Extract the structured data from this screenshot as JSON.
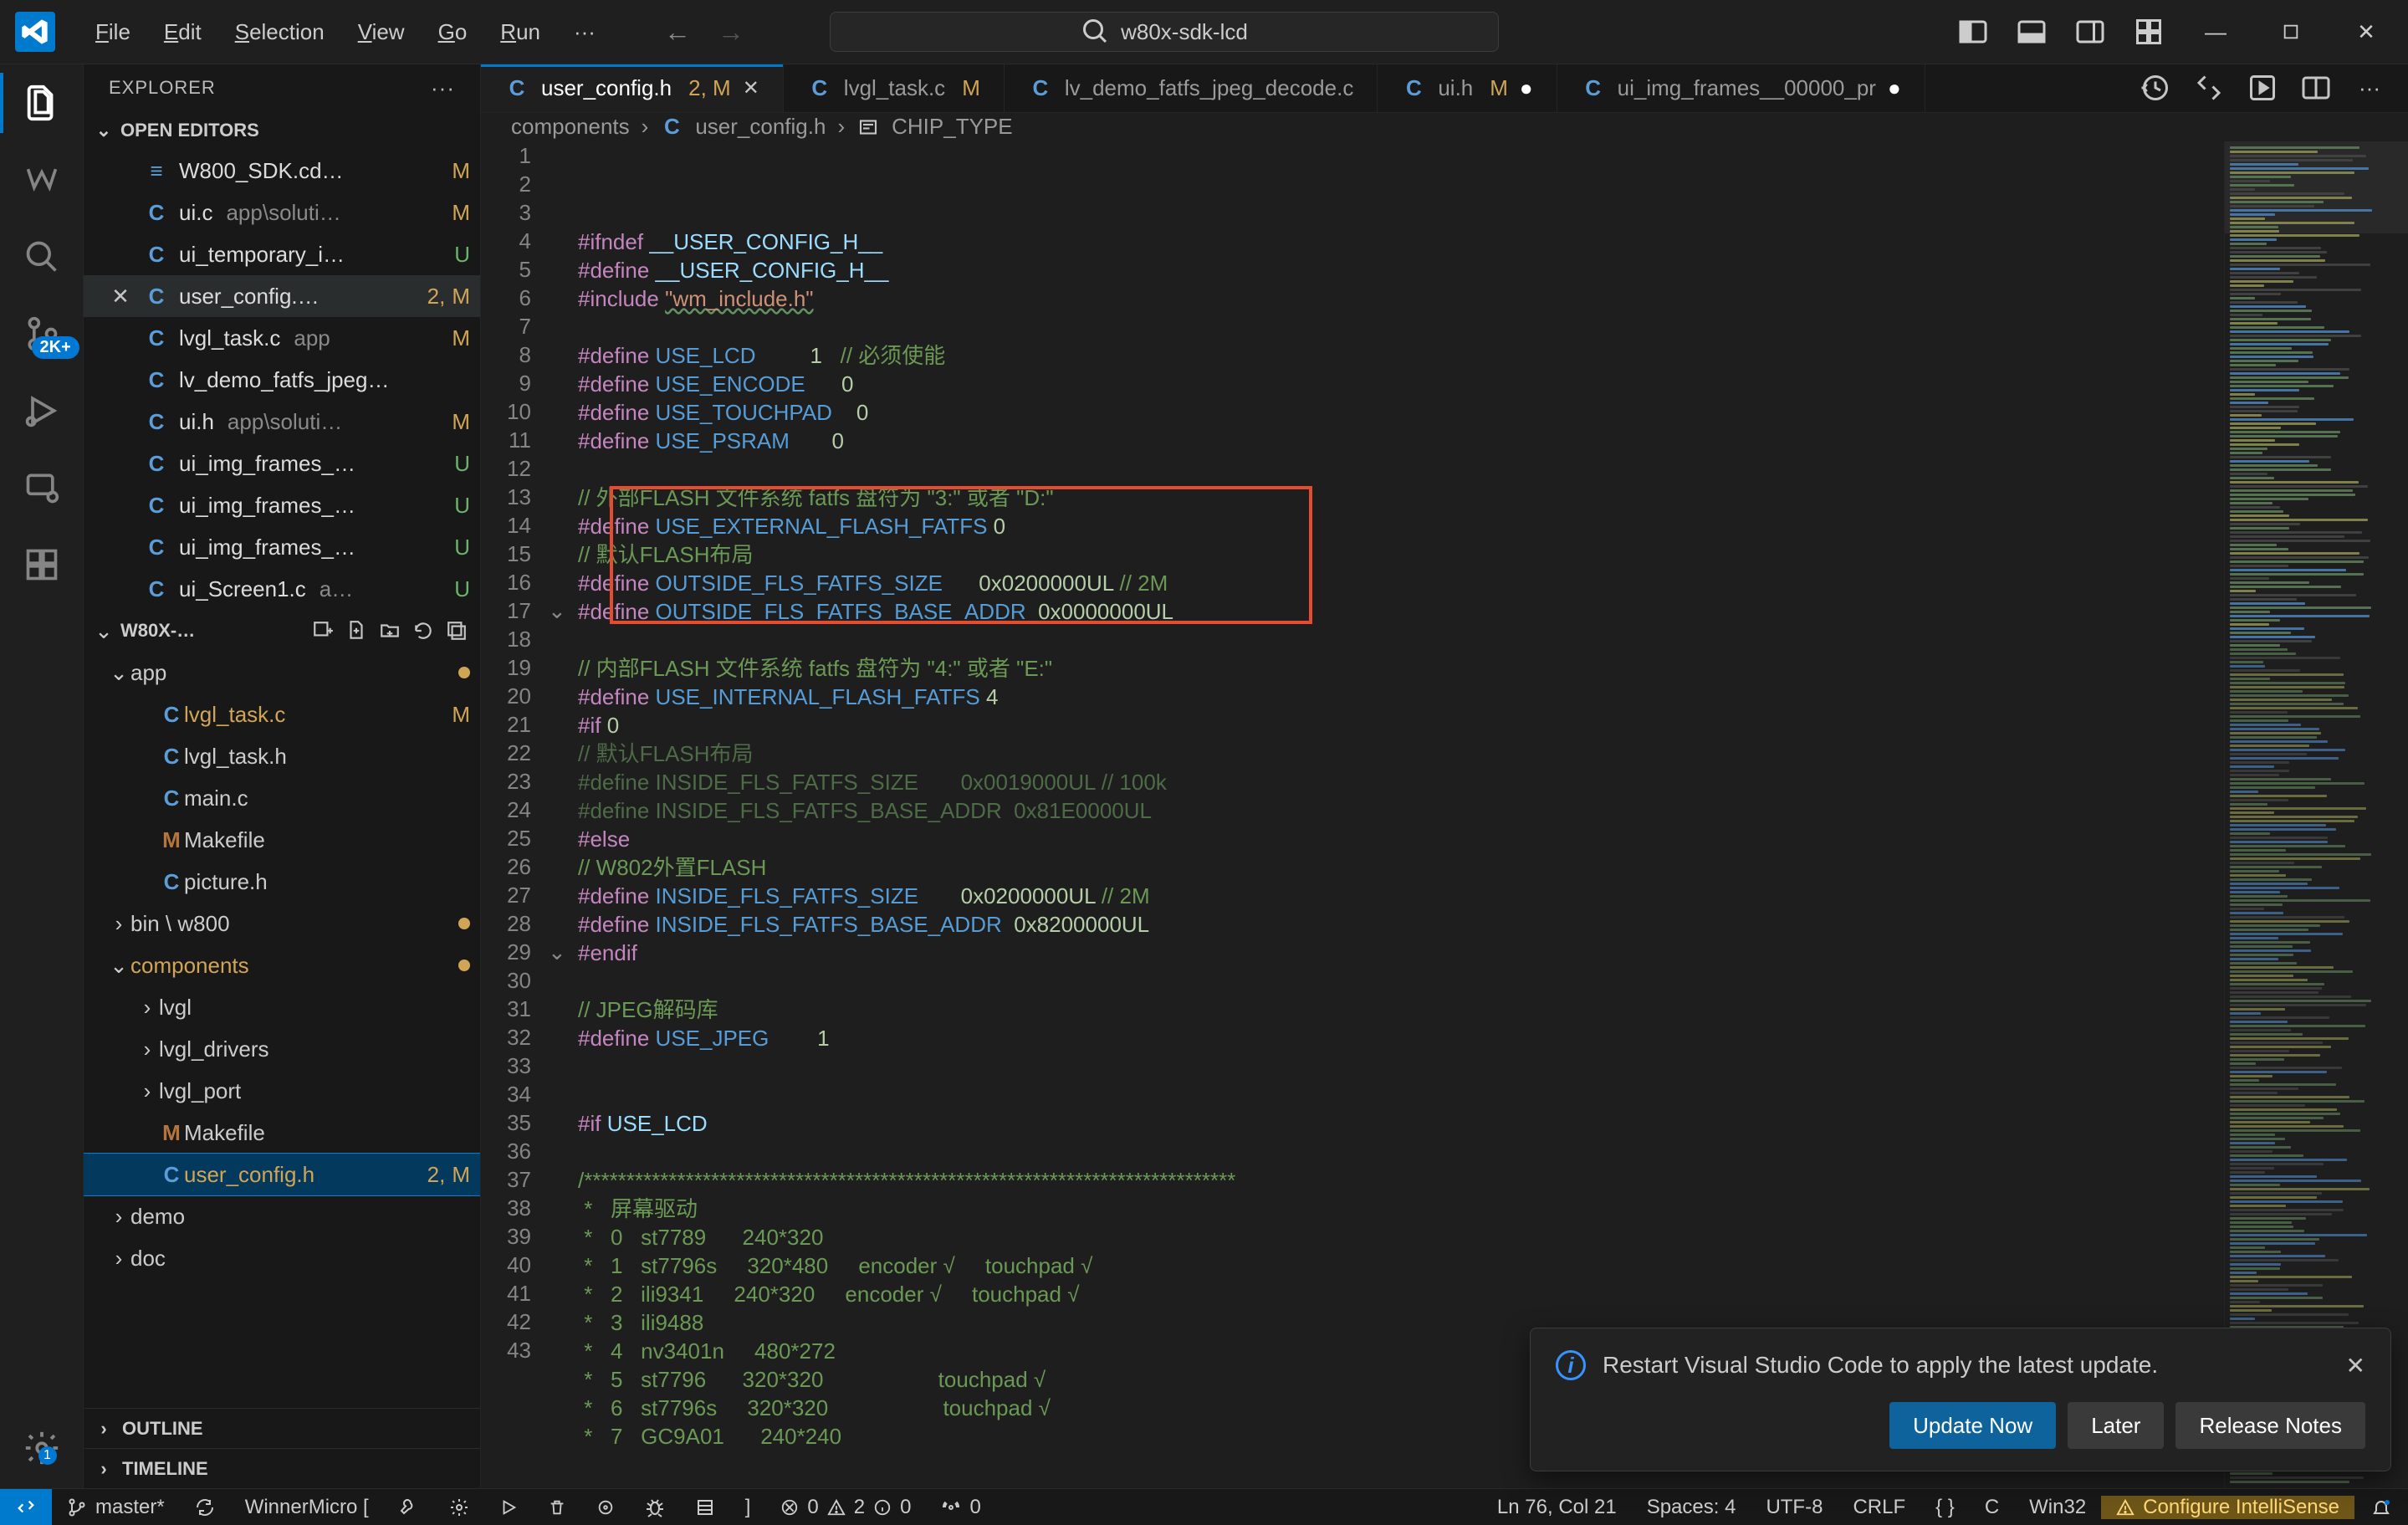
{
  "menus": [
    "File",
    "Edit",
    "Selection",
    "View",
    "Go",
    "Run"
  ],
  "search": {
    "placeholder": "w80x-sdk-lcd"
  },
  "scm_badge": "2K+",
  "sidebar": {
    "title": "EXPLORER",
    "openEditorsLabel": "OPEN EDITORS",
    "openEditors": [
      {
        "icon": "doc",
        "name": "W800_SDK.cd…",
        "path": "",
        "statuses": [
          "M"
        ]
      },
      {
        "icon": "C",
        "name": "ui.c",
        "path": "app\\soluti…",
        "statuses": [
          "M"
        ]
      },
      {
        "icon": "C",
        "name": "ui_temporary_i…",
        "path": "",
        "statuses": [
          "U"
        ]
      },
      {
        "icon": "C",
        "name": "user_config.…",
        "path": "",
        "statuses": [
          "2,",
          "M"
        ],
        "active": true,
        "close": true
      },
      {
        "icon": "C",
        "name": "lvgl_task.c",
        "path": "app",
        "statuses": [
          "M"
        ]
      },
      {
        "icon": "C",
        "name": "lv_demo_fatfs_jpeg…",
        "path": "",
        "statuses": []
      },
      {
        "icon": "C",
        "name": "ui.h",
        "path": "app\\soluti…",
        "statuses": [
          "M"
        ]
      },
      {
        "icon": "C",
        "name": "ui_img_frames_…",
        "path": "",
        "statuses": [
          "U"
        ]
      },
      {
        "icon": "C",
        "name": "ui_img_frames_…",
        "path": "",
        "statuses": [
          "U"
        ]
      },
      {
        "icon": "C",
        "name": "ui_img_frames_…",
        "path": "",
        "statuses": [
          "U"
        ]
      },
      {
        "icon": "C",
        "name": "ui_Screen1.c",
        "path": "a…",
        "statuses": [
          "U"
        ]
      }
    ],
    "projectName": "W80X-…",
    "tree": [
      {
        "indent": 0,
        "type": "folder",
        "name": "app",
        "open": true,
        "status": "dot"
      },
      {
        "indent": 1,
        "type": "file",
        "icon": "C",
        "name": "lvgl_task.c",
        "stat": [
          "M"
        ],
        "git": "m"
      },
      {
        "indent": 1,
        "type": "file",
        "icon": "C",
        "name": "lvgl_task.h"
      },
      {
        "indent": 1,
        "type": "file",
        "icon": "C",
        "name": "main.c"
      },
      {
        "indent": 1,
        "type": "file",
        "icon": "M",
        "name": "Makefile"
      },
      {
        "indent": 1,
        "type": "file",
        "icon": "C",
        "name": "picture.h"
      },
      {
        "indent": 0,
        "type": "folder",
        "name": "bin \\ w800",
        "open": false,
        "status": "dot"
      },
      {
        "indent": 0,
        "type": "folder",
        "name": "components",
        "open": true,
        "status": "dot",
        "git": "m"
      },
      {
        "indent": 1,
        "type": "folder",
        "name": "lvgl",
        "open": false
      },
      {
        "indent": 1,
        "type": "folder",
        "name": "lvgl_drivers",
        "open": false
      },
      {
        "indent": 1,
        "type": "folder",
        "name": "lvgl_port",
        "open": false
      },
      {
        "indent": 1,
        "type": "file",
        "icon": "M",
        "name": "Makefile"
      },
      {
        "indent": 1,
        "type": "file",
        "icon": "C",
        "name": "user_config.h",
        "stat": [
          "2,",
          "M"
        ],
        "git": "m",
        "selected": true
      },
      {
        "indent": 0,
        "type": "folder",
        "name": "demo",
        "open": false
      },
      {
        "indent": 0,
        "type": "folder",
        "name": "doc",
        "open": false
      }
    ],
    "outline": "OUTLINE",
    "timeline": "TIMELINE"
  },
  "tabs": [
    {
      "icon": "C",
      "label": "user_config.h",
      "stat": "2, M",
      "active": true,
      "close": true,
      "dirty": false
    },
    {
      "icon": "C",
      "label": "lvgl_task.c",
      "stat": "M"
    },
    {
      "icon": "C",
      "label": "lv_demo_fatfs_jpeg_decode.c"
    },
    {
      "icon": "C",
      "label": "ui.h",
      "stat": "M",
      "dirty": true
    },
    {
      "icon": "C",
      "label": "ui_img_frames__00000_pr",
      "dirty": true
    }
  ],
  "breadcrumbs": [
    "components",
    "user_config.h",
    "CHIP_TYPE"
  ],
  "code": {
    "startLine": 1,
    "fold_lines": [
      17,
      29
    ],
    "lines": [
      [
        {
          "c": "tok-pp",
          "t": "#ifndef"
        },
        {
          "c": "",
          "t": " "
        },
        {
          "c": "tok-mac",
          "t": "__USER_CONFIG_H__"
        }
      ],
      [
        {
          "c": "tok-pp",
          "t": "#define"
        },
        {
          "c": "",
          "t": " "
        },
        {
          "c": "tok-mac",
          "t": "__USER_CONFIG_H__"
        }
      ],
      [
        {
          "c": "tok-pp",
          "t": "#include"
        },
        {
          "c": "",
          "t": " "
        },
        {
          "c": "tok-str tok-inc-underline",
          "t": "\"wm_include.h\""
        }
      ],
      [],
      [
        {
          "c": "tok-pp",
          "t": "#define"
        },
        {
          "c": "",
          "t": " "
        },
        {
          "c": "tok-def",
          "t": "USE_LCD"
        },
        {
          "c": "",
          "t": "         "
        },
        {
          "c": "tok-num",
          "t": "1"
        },
        {
          "c": "",
          "t": "   "
        },
        {
          "c": "tok-cmt",
          "t": "// 必须使能"
        }
      ],
      [
        {
          "c": "tok-pp",
          "t": "#define"
        },
        {
          "c": "",
          "t": " "
        },
        {
          "c": "tok-def",
          "t": "USE_ENCODE"
        },
        {
          "c": "",
          "t": "      "
        },
        {
          "c": "tok-num",
          "t": "0"
        }
      ],
      [
        {
          "c": "tok-pp",
          "t": "#define"
        },
        {
          "c": "",
          "t": " "
        },
        {
          "c": "tok-def",
          "t": "USE_TOUCHPAD"
        },
        {
          "c": "",
          "t": "    "
        },
        {
          "c": "tok-num",
          "t": "0"
        }
      ],
      [
        {
          "c": "tok-pp",
          "t": "#define"
        },
        {
          "c": "",
          "t": " "
        },
        {
          "c": "tok-def",
          "t": "USE_PSRAM"
        },
        {
          "c": "",
          "t": "       "
        },
        {
          "c": "tok-num",
          "t": "0"
        }
      ],
      [],
      [
        {
          "c": "tok-cmt",
          "t": "// 外部FLASH 文件系统 fatfs 盘符为 \"3:\" 或者 \"D:\""
        }
      ],
      [
        {
          "c": "tok-pp",
          "t": "#define"
        },
        {
          "c": "",
          "t": " "
        },
        {
          "c": "tok-def",
          "t": "USE_EXTERNAL_FLASH_FATFS"
        },
        {
          "c": "",
          "t": " "
        },
        {
          "c": "tok-num",
          "t": "0"
        }
      ],
      [
        {
          "c": "tok-cmt",
          "t": "// 默认FLASH布局"
        }
      ],
      [
        {
          "c": "tok-pp",
          "t": "#define"
        },
        {
          "c": "",
          "t": " "
        },
        {
          "c": "tok-def",
          "t": "OUTSIDE_FLS_FATFS_SIZE"
        },
        {
          "c": "",
          "t": "      "
        },
        {
          "c": "tok-num",
          "t": "0x0200000UL"
        },
        {
          "c": "",
          "t": " "
        },
        {
          "c": "tok-cmt",
          "t": "// 2M"
        }
      ],
      [
        {
          "c": "tok-pp",
          "t": "#define"
        },
        {
          "c": "",
          "t": " "
        },
        {
          "c": "tok-def",
          "t": "OUTSIDE_FLS_FATFS_BASE_ADDR"
        },
        {
          "c": "",
          "t": "  "
        },
        {
          "c": "tok-num",
          "t": "0x0000000UL"
        }
      ],
      [],
      [
        {
          "c": "tok-cmt",
          "t": "// 内部FLASH 文件系统 fatfs 盘符为 \"4:\" 或者 \"E:\""
        }
      ],
      [
        {
          "c": "tok-pp",
          "t": "#define"
        },
        {
          "c": "",
          "t": " "
        },
        {
          "c": "tok-def",
          "t": "USE_INTERNAL_FLASH_FATFS"
        },
        {
          "c": "",
          "t": " "
        },
        {
          "c": "tok-num",
          "t": "4"
        }
      ],
      [
        {
          "c": "tok-pp",
          "t": "#if"
        },
        {
          "c": "",
          "t": " "
        },
        {
          "c": "tok-num",
          "t": "0"
        }
      ],
      [
        {
          "c": "tok-dim",
          "t": "// 默认FLASH布局"
        }
      ],
      [
        {
          "c": "tok-dim",
          "t": "#define INSIDE_FLS_FATFS_SIZE       0x0019000UL // 100k"
        }
      ],
      [
        {
          "c": "tok-dim",
          "t": "#define INSIDE_FLS_FATFS_BASE_ADDR  0x81E0000UL"
        }
      ],
      [
        {
          "c": "tok-pp",
          "t": "#else"
        }
      ],
      [
        {
          "c": "tok-cmt",
          "t": "// W802外置FLASH"
        }
      ],
      [
        {
          "c": "tok-pp",
          "t": "#define"
        },
        {
          "c": "",
          "t": " "
        },
        {
          "c": "tok-def",
          "t": "INSIDE_FLS_FATFS_SIZE"
        },
        {
          "c": "",
          "t": "       "
        },
        {
          "c": "tok-num",
          "t": "0x0200000UL"
        },
        {
          "c": "",
          "t": " "
        },
        {
          "c": "tok-cmt",
          "t": "// 2M"
        }
      ],
      [
        {
          "c": "tok-pp",
          "t": "#define"
        },
        {
          "c": "",
          "t": " "
        },
        {
          "c": "tok-def",
          "t": "INSIDE_FLS_FATFS_BASE_ADDR"
        },
        {
          "c": "",
          "t": "  "
        },
        {
          "c": "tok-num",
          "t": "0x8200000UL"
        }
      ],
      [
        {
          "c": "tok-pp",
          "t": "#endif"
        }
      ],
      [],
      [
        {
          "c": "tok-cmt",
          "t": "// JPEG解码库"
        }
      ],
      [
        {
          "c": "tok-pp",
          "t": "#define"
        },
        {
          "c": "",
          "t": " "
        },
        {
          "c": "tok-def",
          "t": "USE_JPEG"
        },
        {
          "c": "",
          "t": "        "
        },
        {
          "c": "tok-num",
          "t": "1"
        }
      ],
      [],
      [],
      [
        {
          "c": "tok-pp",
          "t": "#if"
        },
        {
          "c": "",
          "t": " "
        },
        {
          "c": "tok-mac",
          "t": "USE_LCD"
        }
      ],
      [],
      [
        {
          "c": "tok-cmt",
          "t": "/*****************************************************************************"
        }
      ],
      [
        {
          "c": "tok-cmt",
          "t": " *   屏幕驱动"
        }
      ],
      [
        {
          "c": "tok-cmt",
          "t": " *   0   st7789      240*320"
        }
      ],
      [
        {
          "c": "tok-cmt",
          "t": " *   1   st7796s     320*480     encoder √     touchpad √"
        }
      ],
      [
        {
          "c": "tok-cmt",
          "t": " *   2   ili9341     240*320     encoder √     touchpad √"
        }
      ],
      [
        {
          "c": "tok-cmt",
          "t": " *   3   ili9488"
        }
      ],
      [
        {
          "c": "tok-cmt",
          "t": " *   4   nv3401n     480*272"
        }
      ],
      [
        {
          "c": "tok-cmt",
          "t": " *   5   st7796      320*320                   touchpad √"
        }
      ],
      [
        {
          "c": "tok-cmt",
          "t": " *   6   st7796s     320*320                   touchpad √"
        }
      ],
      [
        {
          "c": "tok-cmt",
          "t": " *   7   GC9A01      240*240"
        }
      ]
    ]
  },
  "toast": {
    "message": "Restart Visual Studio Code to apply the latest update.",
    "primary": "Update Now",
    "later": "Later",
    "notes": "Release Notes"
  },
  "status": {
    "branch": "master*",
    "sync_post": "",
    "kit": "WinnerMicro [",
    "errors": "0",
    "warnings": "2",
    "info": "0",
    "radio": "0",
    "cursor": "Ln 76, Col 21",
    "spaces": "Spaces: 4",
    "encoding": "UTF-8",
    "eol": "CRLF",
    "braces": "{ }",
    "lang": "C",
    "platform": "Win32",
    "cfg": "Configure IntelliSense"
  }
}
